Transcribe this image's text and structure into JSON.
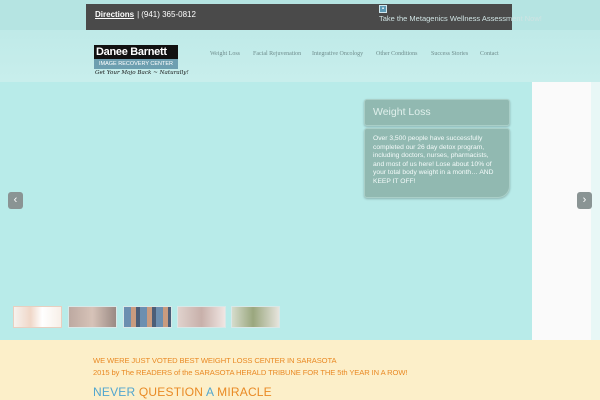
{
  "topbar": {
    "directions_label": "Directions",
    "separator": "|",
    "phone": "(941) 365-0812",
    "assessment_link": "Take the Metagenics Wellness Assessment Now!"
  },
  "logo": {
    "name": "Danee Barnett",
    "subtitle": "IMAGE RECOVERY CENTER",
    "tagline": "Get Your Mojo Back ~ Naturally!"
  },
  "nav": {
    "items": [
      "Weight Loss",
      "Facial Rejuvenation",
      "Integrative Oncology",
      "Other Conditions",
      "Success Stories",
      "Contact"
    ]
  },
  "slider": {
    "caption_title": "Weight Loss",
    "caption_body": "Over 3,500 people have successfully completed our 26 day detox program, including doctors, nurses, pharmacists, and most of us here! Lose about 10% of your total body weight in a month… AND KEEP IT OFF!",
    "prev_label": "‹",
    "next_label": "›",
    "thumbnail_count": 5
  },
  "announcement": {
    "line1": "WE WERE JUST VOTED BEST WEIGHT LOSS CENTER IN SARASOTA",
    "line2": "2015 by The READERS of the SARASOTA HERALD TRIBUNE FOR THE 5th YEAR IN A ROW!"
  },
  "motto": {
    "word1": "NEVER",
    "word2": "QUESTION",
    "word3": "A",
    "word4": "MIRACLE"
  },
  "colors": {
    "accent_orange": "#e98a25",
    "accent_blue": "#52a6cf",
    "slider_bg": "#b8ebe9",
    "caption_bg": "#91b9b1",
    "topbar_bg": "#4a4a4a"
  }
}
